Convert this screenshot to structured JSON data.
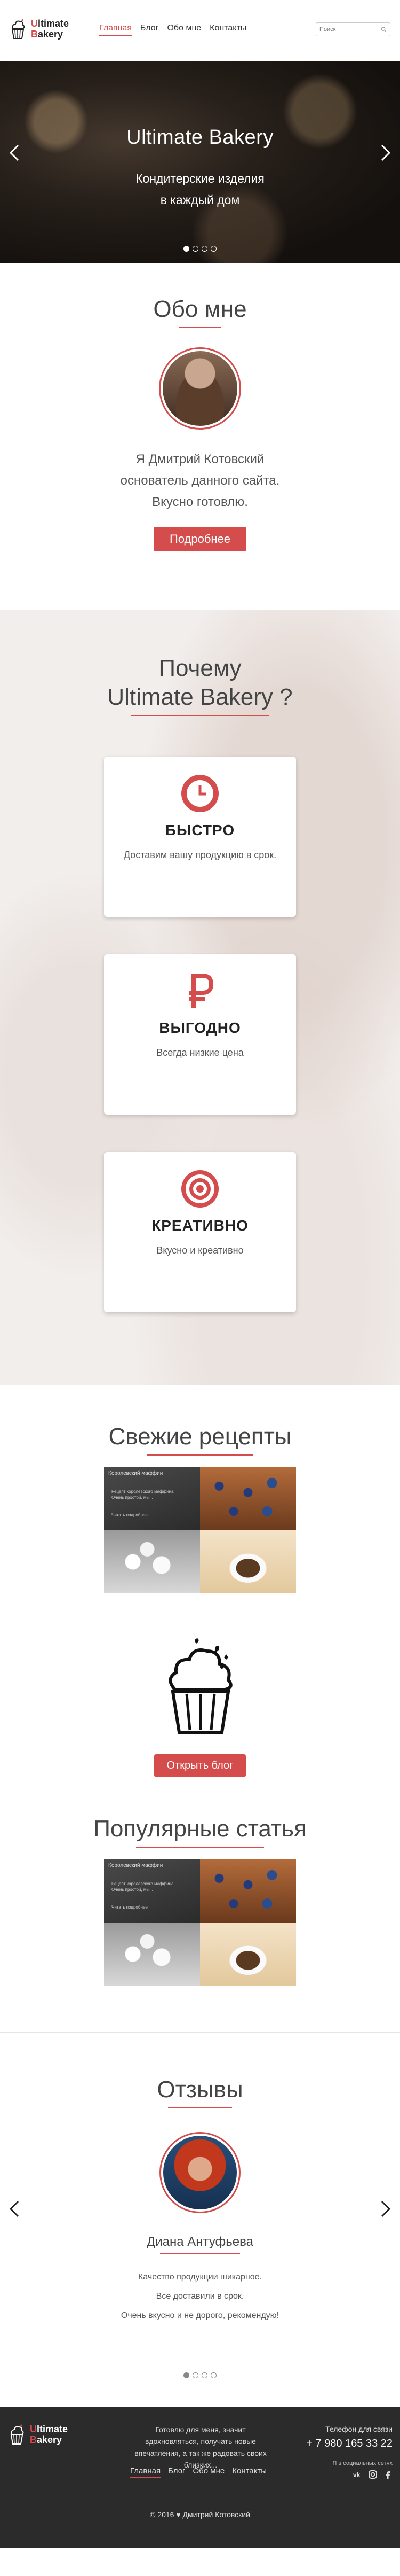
{
  "brand": {
    "line1_first": "U",
    "line1_rest": "ltimate",
    "line2_first": "B",
    "line2_rest": "akery"
  },
  "nav": [
    {
      "label": "Главная",
      "active": true
    },
    {
      "label": "Блог",
      "active": false
    },
    {
      "label": "Обо мне",
      "active": false
    },
    {
      "label": "Контакты",
      "active": false
    }
  ],
  "search": {
    "placeholder": "Поиск"
  },
  "hero": {
    "title": "Ultimate Bakery",
    "subtitle_line1": "Кондитерские изделия",
    "subtitle_line2": "в каждый дом",
    "slides": 4,
    "active_slide": 1
  },
  "about": {
    "title": "Обо мне",
    "line1": "Я Дмитрий Котовский",
    "line2": "основатель данного сайта.",
    "line3": "Вкусно готовлю.",
    "button": "Подробнее"
  },
  "why": {
    "title_line1": "Почему",
    "title_line2": "Ultimate Bakery ?",
    "cards": [
      {
        "icon": "clock-icon",
        "title": "БЫСТРО",
        "text": "Доставим вашу продукцию в срок."
      },
      {
        "icon": "ruble-icon",
        "title": "ВЫГОДНО",
        "text": "Всегда низкие цена"
      },
      {
        "icon": "target-icon",
        "title": "КРЕАТИВНО",
        "text": "Вкусно и креативно"
      }
    ]
  },
  "recipes": {
    "title": "Свежие рецепты",
    "tile_label": "Королевский маффин",
    "tile_sub1": "Рецепт королевского маффина.",
    "tile_sub2": "Очень простой, мы...",
    "tile_link": "Читать подробнее",
    "button": "Открыть блог"
  },
  "popular": {
    "title": "Популярные статья",
    "tile_label": "Королевский маффин",
    "tile_sub1": "Рецепт королевского маффина.",
    "tile_sub2": "Очень простой, мы...",
    "tile_link": "Читать подробнее"
  },
  "reviews": {
    "title": "Отзывы",
    "name": "Диана Антуфьева",
    "line1": "Качество продукции шикарное.",
    "line2": "Все доставили в срок.",
    "line3": "Очень вкусно и не дорого, рекомендую!",
    "slides": 4,
    "active_slide": 1
  },
  "footer": {
    "about": "Готовлю для меня, значит вдохновляться, получать новые впечатления, а так же радовать своих близких...",
    "nav": [
      "Главная",
      "Блог",
      "Обо мне",
      "Контакты"
    ],
    "phone_label": "Телефон для связи",
    "phone": "+ 7 980 165 33 22",
    "social_label": "Я в социальных сетях",
    "social": [
      "vk-icon",
      "instagram-icon",
      "facebook-icon"
    ],
    "copyright": "© 2016 ♥ Дмитрий Котовский"
  },
  "colors": {
    "accent": "#d44c4c",
    "footer_bg": "#2b2b2b"
  }
}
